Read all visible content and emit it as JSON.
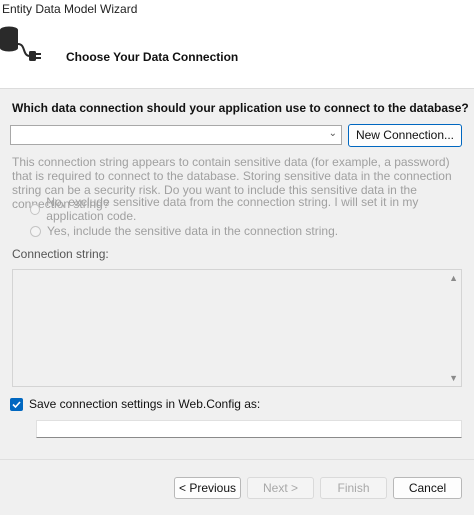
{
  "window": {
    "title": "Entity Data Model Wizard"
  },
  "header": {
    "title": "Choose Your Data Connection",
    "icon": "database-plug-icon"
  },
  "connection": {
    "question": "Which data connection should your application use to connect to the database?",
    "selected": "",
    "new_button": "New Connection..."
  },
  "sensitive": {
    "message": "This connection string appears to contain sensitive data (for example, a password) that is required to connect to the database. Storing sensitive data in the connection string can be a security risk. Do you want to include this sensitive data in the connection string?",
    "option_no": "No, exclude sensitive data from the connection string. I will set it in my application code.",
    "option_yes": "Yes, include the sensitive data in the connection string."
  },
  "connection_string": {
    "label": "Connection string:",
    "value": ""
  },
  "save": {
    "label": "Save connection settings in Web.Config as:",
    "checked": true,
    "value": ""
  },
  "footer": {
    "previous": "< Previous",
    "next": "Next >",
    "finish": "Finish",
    "cancel": "Cancel"
  },
  "colors": {
    "accent": "#0067c0",
    "disabled_text": "#a0a0a0",
    "panel": "#f0f0f0"
  }
}
